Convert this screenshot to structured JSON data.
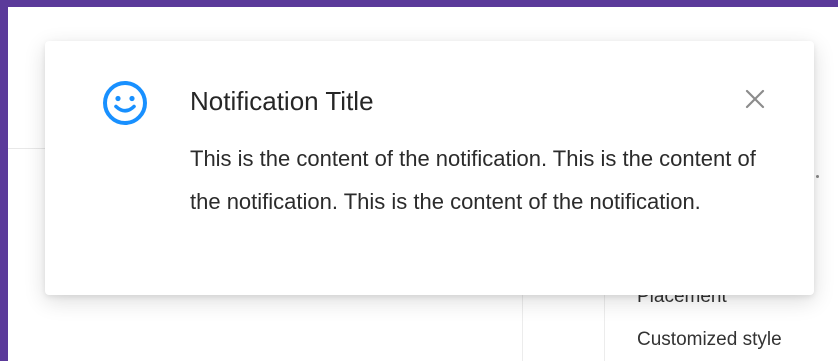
{
  "notification": {
    "icon": "smile-icon",
    "title": "Notification Title",
    "content": "This is the content of the notification. This is the content of the notification. This is the content of the notification.",
    "close_icon": "close-icon"
  },
  "anchor": {
    "items": [
      {
        "label": "Placement"
      },
      {
        "label": "Customized style"
      }
    ]
  },
  "colors": {
    "frame": "#5b3a9a",
    "icon_accent": "#1890ff",
    "title_text": "#262626",
    "close_icon": "#8c8c8c"
  }
}
